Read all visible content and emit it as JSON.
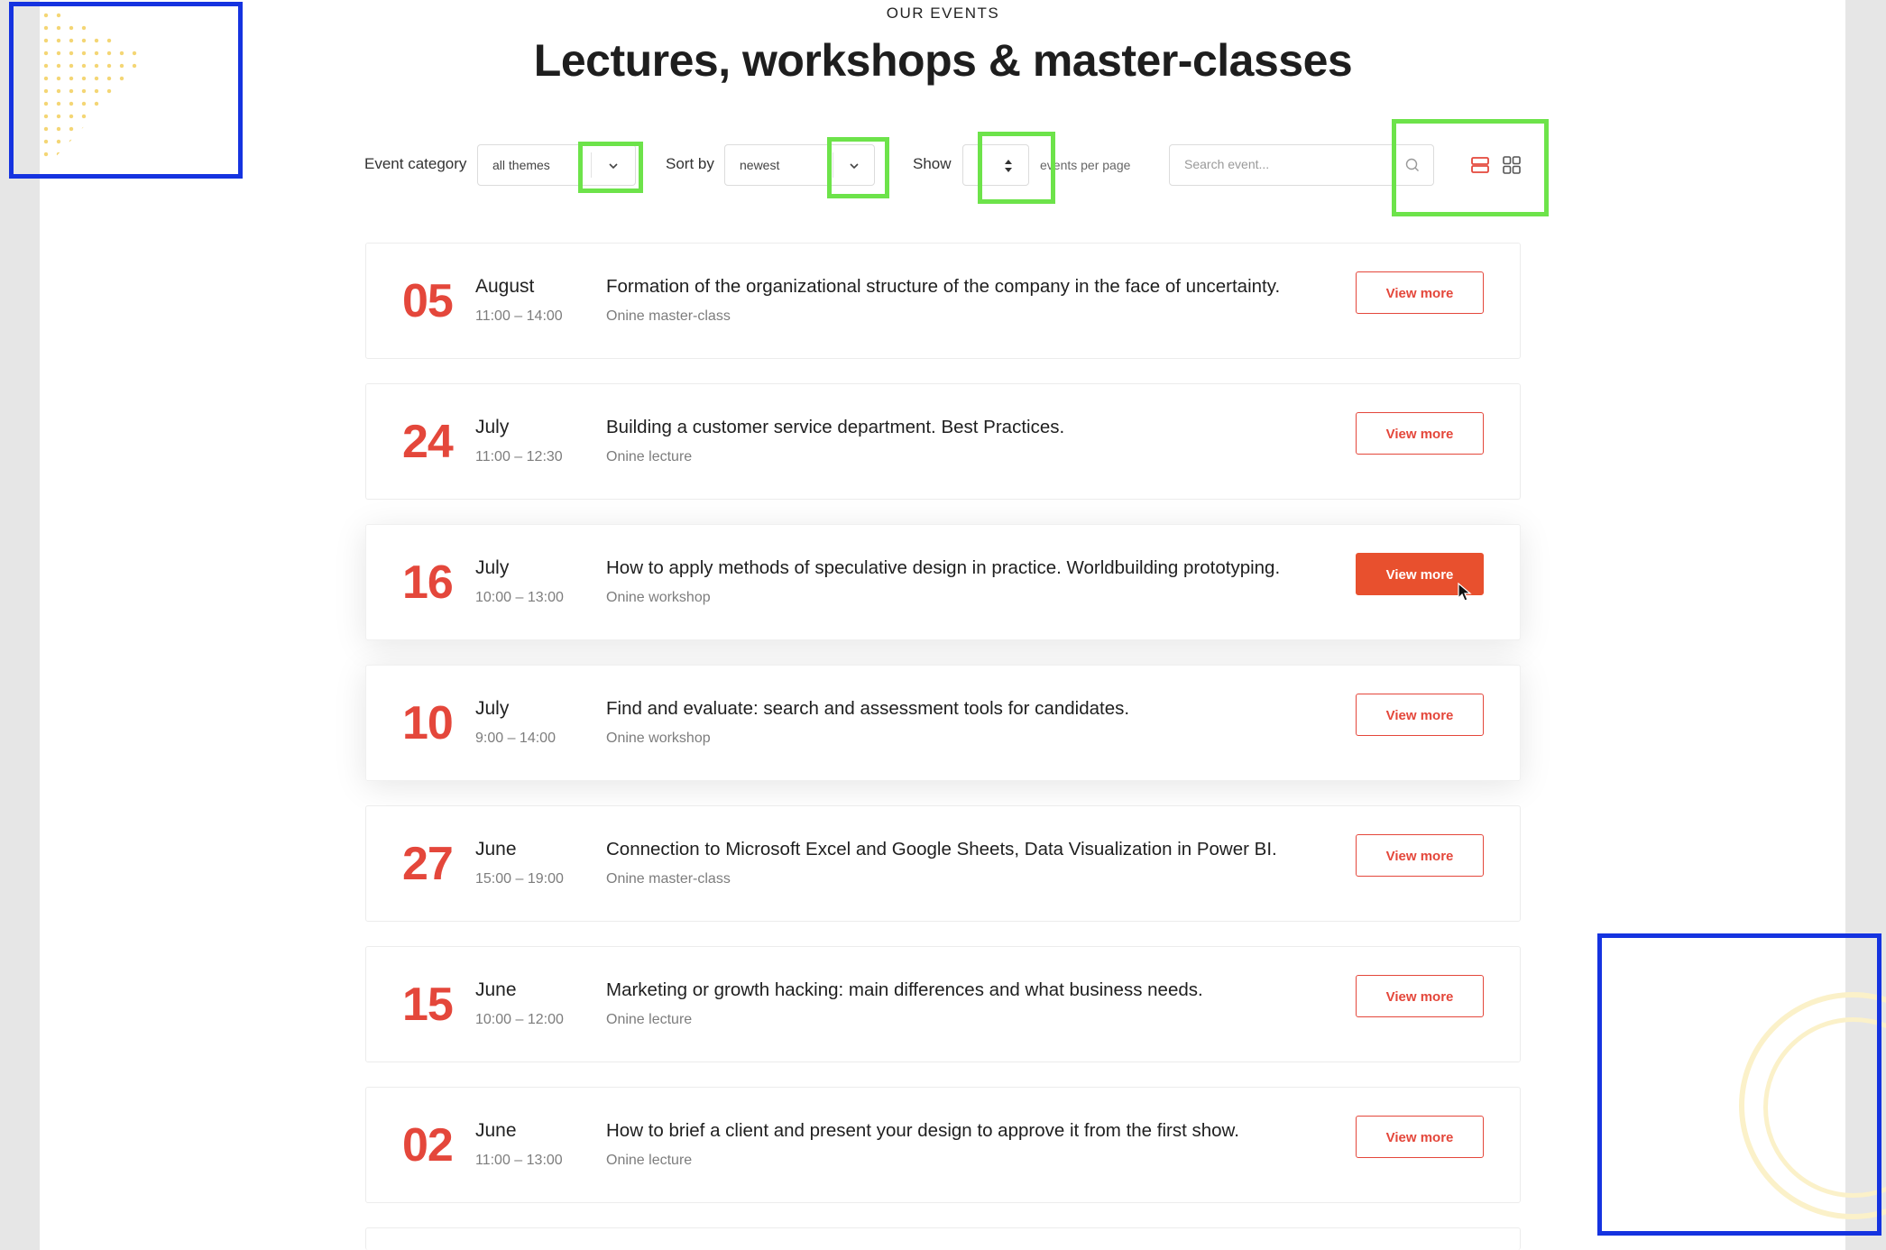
{
  "header": {
    "eyebrow": "OUR EVENTS",
    "title": "Lectures, workshops & master-classes"
  },
  "filters": {
    "category_label": "Event category",
    "category_value": "all themes",
    "sort_label": "Sort by",
    "sort_value": "newest",
    "show_label": "Show",
    "show_value": "",
    "per_page_suffix": "events per page",
    "search_placeholder": "Search event..."
  },
  "events": [
    {
      "day": "05",
      "month": "August",
      "time": "11:00 – 14:00",
      "title": "Formation of the organizational structure of the company in the face of uncertainty.",
      "type": "Onine master-class",
      "button": "View more"
    },
    {
      "day": "24",
      "month": "July",
      "time": "11:00 – 12:30",
      "title": "Building a customer service department. Best Practices.",
      "type": "Onine lecture",
      "button": "View more"
    },
    {
      "day": "16",
      "month": "July",
      "time": "10:00 – 13:00",
      "title": "How to apply methods of speculative design in practice. Worldbuilding prototyping.",
      "type": "Onine workshop",
      "button": "View more"
    },
    {
      "day": "10",
      "month": "July",
      "time": "9:00 – 14:00",
      "title": "Find and evaluate: search and assessment tools for candidates.",
      "type": "Onine workshop",
      "button": "View more"
    },
    {
      "day": "27",
      "month": "June",
      "time": "15:00 – 19:00",
      "title": "Connection to Microsoft Excel and Google Sheets, Data Visualization in Power BI.",
      "type": "Onine master-class",
      "button": "View more"
    },
    {
      "day": "15",
      "month": "June",
      "time": "10:00 – 12:00",
      "title": "Marketing or growth hacking: main differences and what business needs.",
      "type": "Onine lecture",
      "button": "View more"
    },
    {
      "day": "02",
      "month": "June",
      "time": "11:00 – 13:00",
      "title": "How to brief a client and present your design to approve it from the first show.",
      "type": "Onine lecture",
      "button": "View more"
    }
  ],
  "colors": {
    "accent": "#e4473b",
    "button_active": "#e8502e",
    "annotation_blue": "#1533e0",
    "annotation_green": "#6de34a"
  },
  "icons": [
    "chevron-down-icon",
    "sort-arrows-icon",
    "search-icon",
    "list-view-icon",
    "grid-view-icon",
    "cursor-icon"
  ]
}
